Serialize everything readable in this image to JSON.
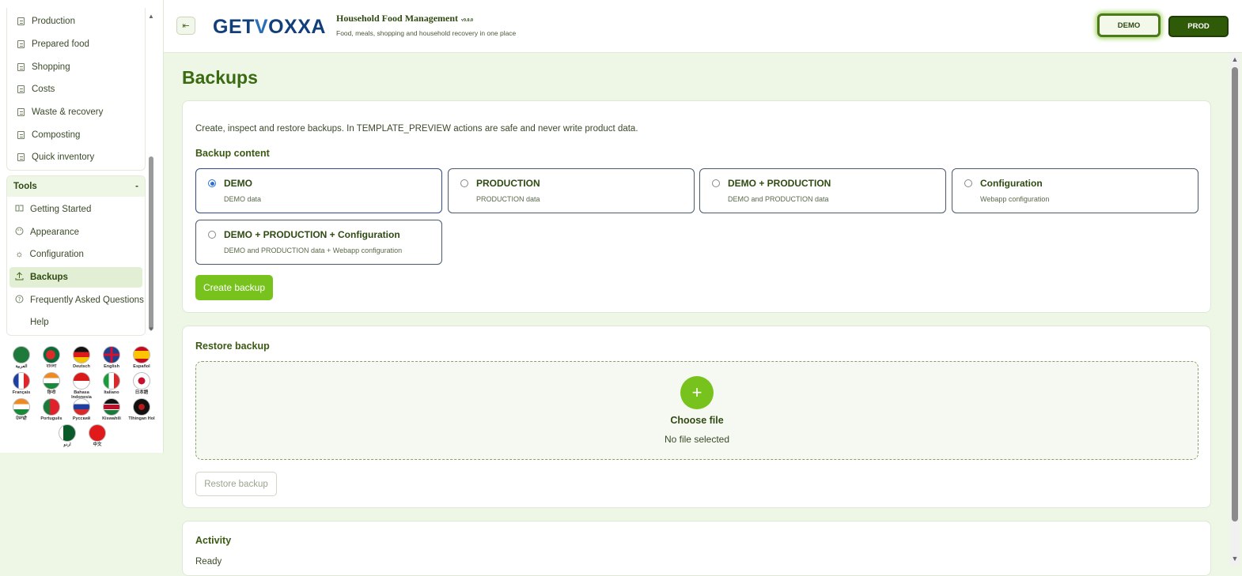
{
  "sidebar": {
    "nav_items": [
      {
        "label": "Production"
      },
      {
        "label": "Prepared food"
      },
      {
        "label": "Shopping"
      },
      {
        "label": "Costs"
      },
      {
        "label": "Waste & recovery"
      },
      {
        "label": "Composting"
      },
      {
        "label": "Quick inventory"
      }
    ],
    "tools_title": "Tools",
    "tools_toggle": "-",
    "tools": [
      {
        "label": "Getting Started",
        "icon": "book-icon"
      },
      {
        "label": "Appearance",
        "icon": "palette-icon"
      },
      {
        "label": "Configuration",
        "icon": "gear-icon"
      },
      {
        "label": "Backups",
        "icon": "upload-icon",
        "active": true
      },
      {
        "label": "Frequently Asked Questions",
        "icon": "question-icon"
      },
      {
        "label": "Help",
        "icon": ""
      }
    ],
    "languages": [
      {
        "label": "العربية",
        "color": "#1e7a3a"
      },
      {
        "label": "বাংলা",
        "color": "#0a6a3a"
      },
      {
        "label": "Deutsch",
        "color": "#d8a000"
      },
      {
        "label": "English",
        "color": "#1f3f8f"
      },
      {
        "label": "Español",
        "color": "#d82a1a"
      },
      {
        "label": "Français",
        "color": "#2a4ab0"
      },
      {
        "label": "हिन्दी",
        "color": "#f08a20"
      },
      {
        "label": "Bahasa Indonesia",
        "color": "#d81a1a"
      },
      {
        "label": "Italiano",
        "color": "#1a9a3a"
      },
      {
        "label": "日本語",
        "color": "#ffffff"
      },
      {
        "label": "ਪੰਜਾਬੀ",
        "color": "#f08a20"
      },
      {
        "label": "Português",
        "color": "#1a8a3a"
      },
      {
        "label": "Русский",
        "color": "#2a4ab0"
      },
      {
        "label": "Kiswahili",
        "color": "#1a1a1a"
      },
      {
        "label": "Tlhingan Hol",
        "color": "#1a1a1a"
      },
      {
        "label": "اردو",
        "color": "#0a5a2a"
      },
      {
        "label": "中文",
        "color": "#e01a1a"
      }
    ]
  },
  "header": {
    "logo_text_a": "GET",
    "logo_text_v": "V",
    "logo_text_b": "OXXA",
    "app_title": "Household Food Management",
    "version": "v9.0.0",
    "subtitle": "Food, meals, shopping and household recovery in one place",
    "demo_label": "DEMO",
    "prod_label": "PROD"
  },
  "main": {
    "page_title": "Backups",
    "description": "Create, inspect and restore backups. In TEMPLATE_PREVIEW actions are safe and never write product data.",
    "backup_content_title": "Backup content",
    "options": [
      {
        "title": "DEMO",
        "subtitle": "DEMO data",
        "selected": true
      },
      {
        "title": "PRODUCTION",
        "subtitle": "PRODUCTION data",
        "selected": false
      },
      {
        "title": "DEMO + PRODUCTION",
        "subtitle": "DEMO and PRODUCTION data",
        "selected": false
      },
      {
        "title": "Configuration",
        "subtitle": "Webapp configuration",
        "selected": false
      },
      {
        "title": "DEMO + PRODUCTION + Configuration",
        "subtitle": "DEMO and PRODUCTION data + Webapp configuration",
        "selected": false
      }
    ],
    "create_button": "Create backup",
    "restore_title": "Restore backup",
    "choose_file": "Choose file",
    "no_file": "No file selected",
    "restore_button": "Restore backup",
    "activity_title": "Activity",
    "activity_status": "Ready"
  },
  "colors": {
    "accent": "#78c21e",
    "brand_dark": "#2f5a08",
    "page_bg": "#eef6e6"
  }
}
